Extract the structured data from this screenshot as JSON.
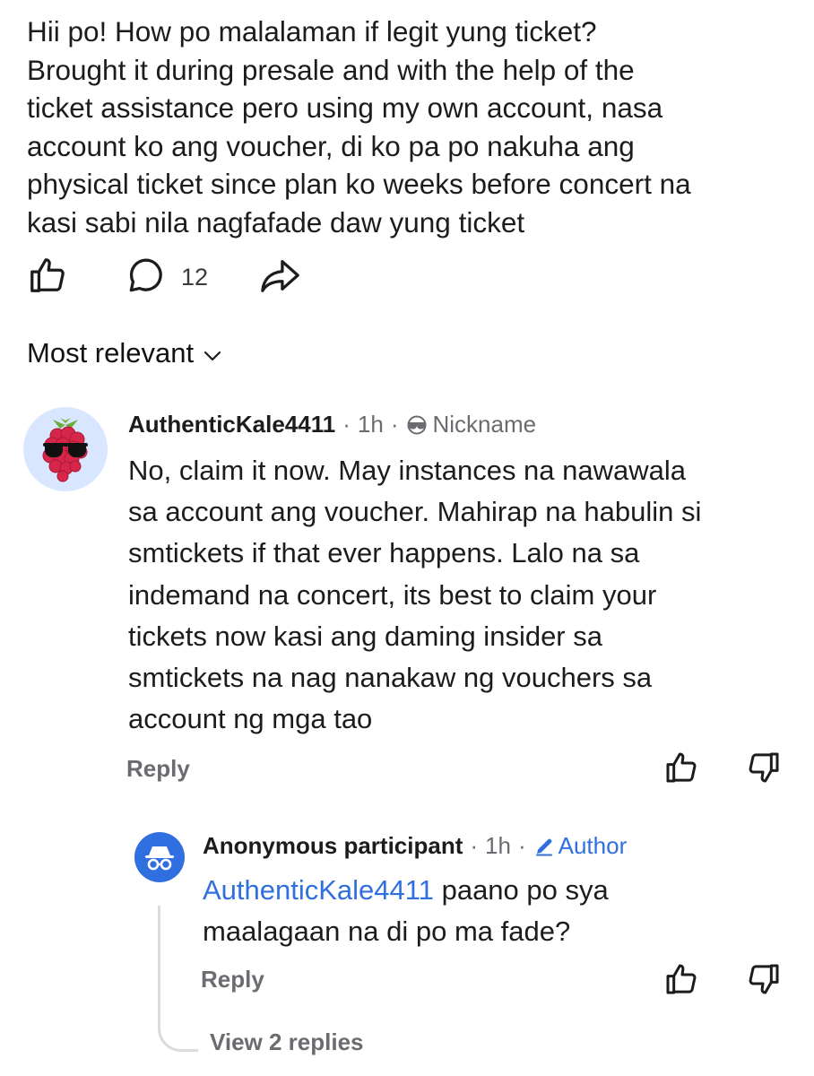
{
  "post": {
    "body": "Hii po! How po malalaman if legit yung ticket?\nBrought it during presale and with the help of the\nticket assistance pero using my own account, nasa\naccount ko ang voucher, di ko pa po nakuha ang\nphysical ticket since plan ko weeks before concert na\nkasi sabi nila nagfafade daw yung ticket",
    "comment_count": "12"
  },
  "sort": {
    "label": "Most relevant"
  },
  "comments": [
    {
      "username": "AuthenticKale4411",
      "time": "1h",
      "flair": "Nickname",
      "body": "No, claim it now. May instances na nawawala\nsa account ang voucher. Mahirap na habulin si\nsmtickets if that ever happens. Lalo na sa\nindemand na concert, its best to claim your\ntickets now kasi ang daming insider sa\nsmtickets na nag nanakaw ng vouchers sa\naccount ng mga tao",
      "reply_label": "Reply"
    }
  ],
  "reply": {
    "username": "Anonymous participant",
    "time": "1h",
    "badge": "Author",
    "mention": "AuthenticKale4411",
    "body_line1": " paano po sya",
    "body_line2": "maalagaan na di po ma fade?",
    "reply_label": "Reply",
    "view_replies": "View 2 replies"
  },
  "colors": {
    "accent": "#2f6fe0",
    "muted": "#6b6b70",
    "text": "#1c1c1e"
  },
  "icons": [
    "upvote-icon",
    "comment-icon",
    "share-icon",
    "chevron-down-icon",
    "sunglasses-icon",
    "pencil-icon",
    "incognito-icon",
    "downvote-icon"
  ]
}
